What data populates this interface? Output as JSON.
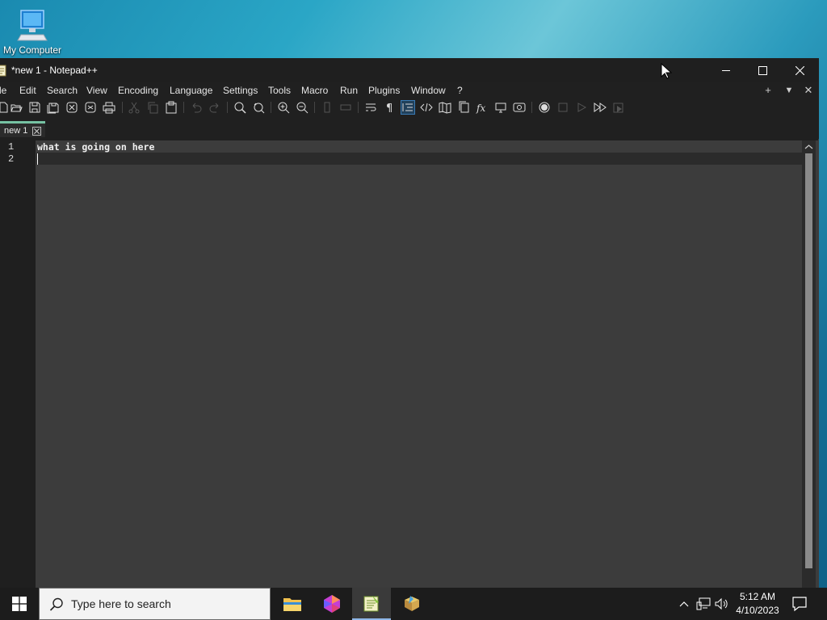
{
  "desktop": {
    "icon_label": "My Computer"
  },
  "window": {
    "title": "*new 1 - Notepad++",
    "menu": [
      "le",
      "Edit",
      "Search",
      "View",
      "Encoding",
      "Language",
      "Settings",
      "Tools",
      "Macro",
      "Run",
      "Plugins",
      "Window",
      "?"
    ],
    "menu_right": [
      "+",
      "▼",
      "✕"
    ],
    "tab": {
      "label": "new 1"
    },
    "editor": {
      "line_numbers": [
        "1",
        "2"
      ],
      "lines": [
        "what is going on here",
        ""
      ]
    }
  },
  "taskbar": {
    "search_placeholder": "Type here to search",
    "time": "5:12 AM",
    "date": "4/10/2023"
  },
  "colors": {
    "accent_tab": "#76c2a3",
    "editor_bg": "#3c3c3c",
    "chrome_bg": "#202020"
  },
  "icons": [
    "computer-icon",
    "notepadpp-icon",
    "minimize-icon",
    "maximize-icon",
    "close-icon",
    "windows-start-icon",
    "search-icon",
    "file-explorer-icon",
    "colorful-app-icon",
    "notepadpp-taskbar-icon",
    "paint-app-icon",
    "chevron-up-icon",
    "network-icon",
    "volume-icon",
    "notification-icon"
  ]
}
